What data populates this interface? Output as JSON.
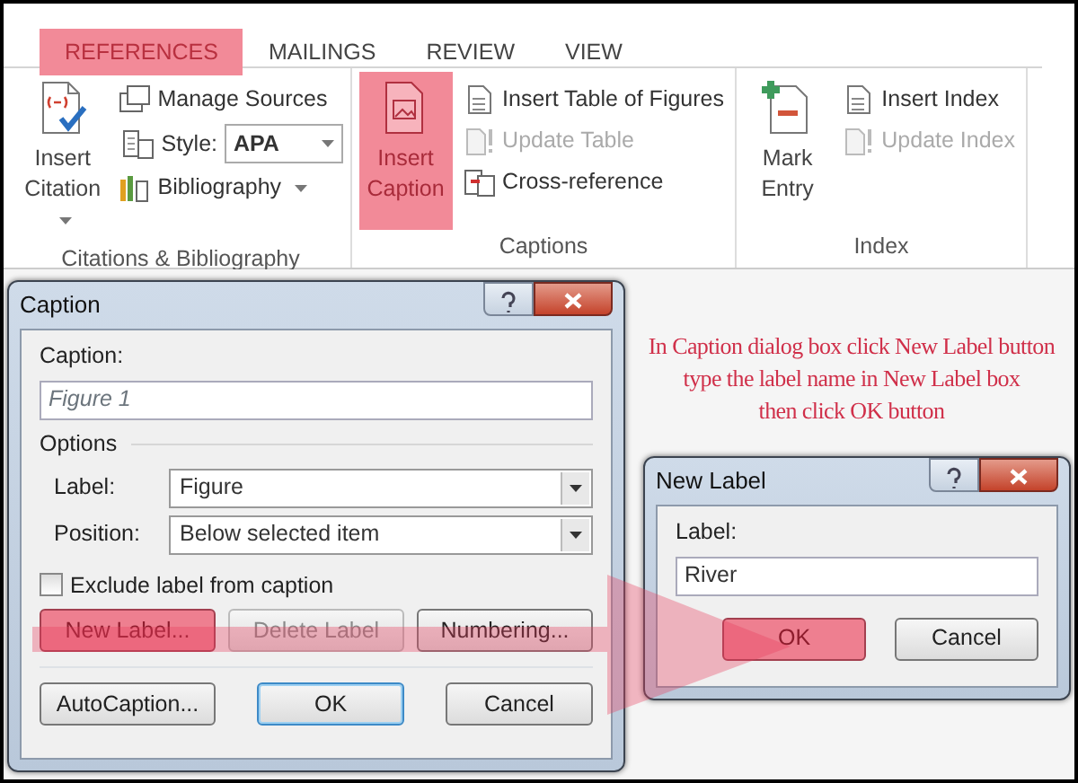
{
  "ribbon": {
    "tabs": [
      {
        "label": "REFERENCES",
        "selected": true
      },
      {
        "label": "MAILINGS",
        "selected": false
      },
      {
        "label": "REVIEW",
        "selected": false
      },
      {
        "label": "VIEW",
        "selected": false
      }
    ],
    "groups": [
      {
        "title": "Citations & Bibliography",
        "items": [
          {
            "kind": "large",
            "label": "Insert Citation",
            "dropdown": true,
            "highlighted": false
          },
          {
            "kind": "small",
            "label": "Manage Sources",
            "dropdown": false,
            "disabled": false
          },
          {
            "kind": "style",
            "label": "Style:",
            "value": "APA"
          },
          {
            "kind": "small",
            "label": "Bibliography",
            "dropdown": true,
            "disabled": false
          }
        ]
      },
      {
        "title": "Captions",
        "items": [
          {
            "kind": "large",
            "label": "Insert Caption",
            "dropdown": false,
            "highlighted": true
          },
          {
            "kind": "small",
            "label": "Insert Table of Figures",
            "dropdown": false,
            "disabled": false
          },
          {
            "kind": "small",
            "label": "Update Table",
            "dropdown": false,
            "disabled": true
          },
          {
            "kind": "small",
            "label": "Cross-reference",
            "dropdown": false,
            "disabled": false
          }
        ]
      },
      {
        "title": "Index",
        "items": [
          {
            "kind": "large",
            "label": "Mark Entry",
            "dropdown": false,
            "highlighted": false
          },
          {
            "kind": "small",
            "label": "Insert Index",
            "dropdown": false,
            "disabled": false
          },
          {
            "kind": "small",
            "label": "Update Index",
            "dropdown": false,
            "disabled": true
          }
        ]
      }
    ]
  },
  "caption_dialog": {
    "title": "Caption",
    "caption_label": {
      "text": "Caption:"
    },
    "caption_value": "Figure 1",
    "options_title": "Options",
    "fields": [
      {
        "label": "Label:",
        "value": "Figure"
      },
      {
        "label": "Position:",
        "value": "Below selected item"
      }
    ],
    "checkbox": {
      "label": "Exclude label from caption",
      "checked": false
    },
    "label_buttons": [
      {
        "label": "New Label...",
        "highlighted": true,
        "disabled": false
      },
      {
        "label": "Delete Label",
        "highlighted": false,
        "disabled": true
      },
      {
        "label": "Numbering...",
        "highlighted": false,
        "disabled": false
      }
    ],
    "bottom_buttons": [
      {
        "label": "AutoCaption...",
        "default": false
      },
      {
        "label": "OK",
        "default": true
      },
      {
        "label": "Cancel",
        "default": false
      }
    ]
  },
  "annotation": {
    "text": "In Caption dialog box click New Label button\ntype the label name in New Label box\nthen click OK button"
  },
  "new_label_dialog": {
    "title": "New Label",
    "label": {
      "text": "Label:"
    },
    "value": "River",
    "buttons": [
      {
        "label": "OK",
        "highlighted": true
      },
      {
        "label": "Cancel",
        "highlighted": false
      }
    ]
  }
}
